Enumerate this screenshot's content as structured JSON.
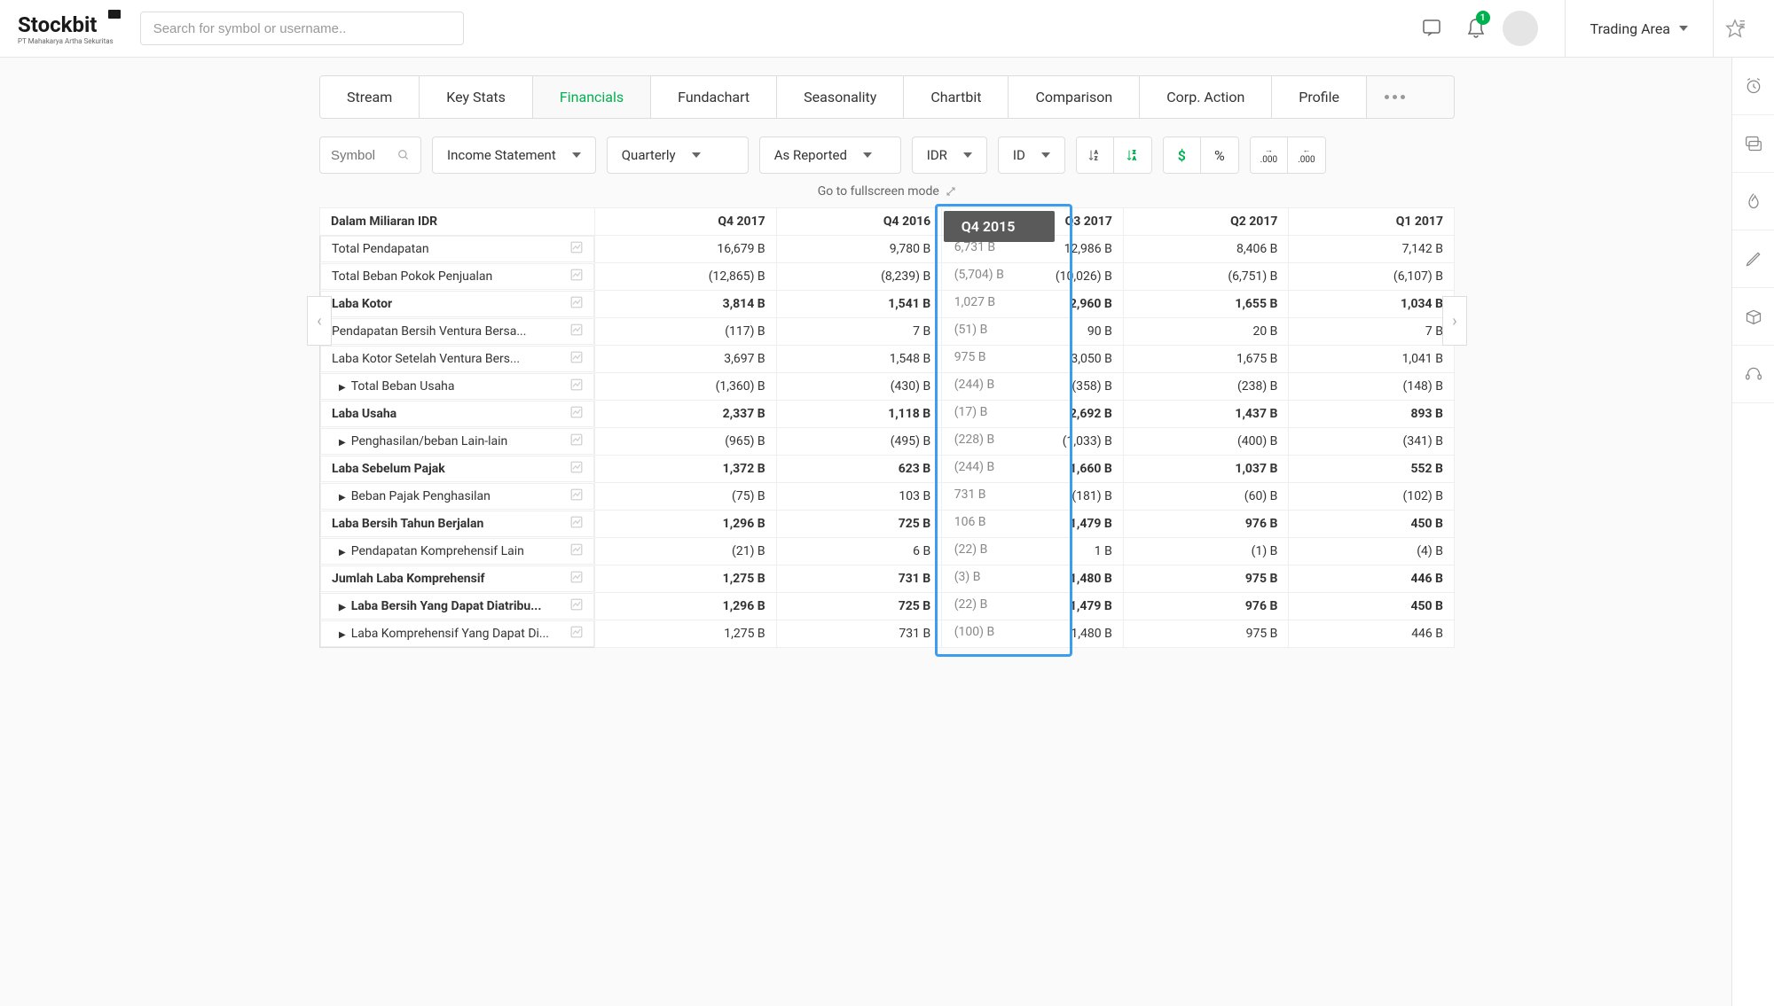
{
  "header": {
    "brand": "Stockbit",
    "brand_sub": "PT Mahakarya Artha Sekuritas",
    "search_placeholder": "Search for symbol or username..",
    "notif_badge": "1",
    "trading_area": "Trading Area"
  },
  "tabs": [
    "Stream",
    "Key Stats",
    "Financials",
    "Fundachart",
    "Seasonality",
    "Chartbit",
    "Comparison",
    "Corp. Action",
    "Profile"
  ],
  "active_tab": 2,
  "controls": {
    "symbol_placeholder": "Symbol",
    "statement": "Income Statement",
    "period": "Quarterly",
    "basis": "As Reported",
    "currency": "IDR",
    "locale": "ID",
    "dollar": "$",
    "percent": "%",
    "dec_inc": ".000",
    "dec_dec": ".000"
  },
  "fullscreen": "Go to fullscreen mode",
  "table_header_first": "Dalam Miliaran IDR",
  "columns": [
    "Q4 2017",
    "Q4 2016",
    "Q3 2017",
    "Q2 2017",
    "Q1 2017"
  ],
  "tooltip": {
    "header": "Q4 2015",
    "values": [
      "6,731 B",
      "(5,704) B",
      "1,027 B",
      "(51) B",
      "975 B",
      "(244) B",
      "(17) B",
      "(228) B",
      "(244) B",
      "731 B",
      "106 B",
      "(22) B",
      "(3) B",
      "(22) B",
      "(100) B"
    ]
  },
  "rows": [
    {
      "label": "Total Pendapatan",
      "bold": false,
      "indent": 0,
      "expand": false,
      "values": [
        "16,679 B",
        "9,780 B",
        "12,986 B",
        "8,406 B",
        "7,142 B"
      ]
    },
    {
      "label": "Total Beban Pokok Penjualan",
      "bold": false,
      "indent": 0,
      "expand": false,
      "values": [
        "(12,865) B",
        "(8,239) B",
        "(10,026) B",
        "(6,751) B",
        "(6,107) B"
      ]
    },
    {
      "label": "Laba Kotor",
      "bold": true,
      "indent": 0,
      "expand": false,
      "values": [
        "3,814 B",
        "1,541 B",
        "2,960 B",
        "1,655 B",
        "1,034 B"
      ]
    },
    {
      "label": "Pendapatan Bersih Ventura Bersa...",
      "bold": false,
      "indent": 0,
      "expand": false,
      "values": [
        "(117) B",
        "7 B",
        "90 B",
        "20 B",
        "7 B"
      ]
    },
    {
      "label": "Laba Kotor Setelah Ventura Bers...",
      "bold": false,
      "indent": 0,
      "expand": false,
      "values": [
        "3,697 B",
        "1,548 B",
        "3,050 B",
        "1,675 B",
        "1,041 B"
      ]
    },
    {
      "label": "Total Beban Usaha",
      "bold": false,
      "indent": 1,
      "expand": true,
      "values": [
        "(1,360) B",
        "(430) B",
        "(358) B",
        "(238) B",
        "(148) B"
      ]
    },
    {
      "label": "Laba Usaha",
      "bold": true,
      "indent": 0,
      "expand": false,
      "values": [
        "2,337 B",
        "1,118 B",
        "2,692 B",
        "1,437 B",
        "893 B"
      ]
    },
    {
      "label": "Penghasilan/beban Lain-lain",
      "bold": false,
      "indent": 1,
      "expand": true,
      "values": [
        "(965) B",
        "(495) B",
        "(1,033) B",
        "(400) B",
        "(341) B"
      ]
    },
    {
      "label": "Laba Sebelum Pajak",
      "bold": true,
      "indent": 0,
      "expand": false,
      "values": [
        "1,372 B",
        "623 B",
        "1,660 B",
        "1,037 B",
        "552 B"
      ]
    },
    {
      "label": "Beban Pajak Penghasilan",
      "bold": false,
      "indent": 1,
      "expand": true,
      "values": [
        "(75) B",
        "103 B",
        "(181) B",
        "(60) B",
        "(102) B"
      ]
    },
    {
      "label": "Laba Bersih Tahun Berjalan",
      "bold": true,
      "indent": 0,
      "expand": false,
      "values": [
        "1,296 B",
        "725 B",
        "1,479 B",
        "976 B",
        "450 B"
      ]
    },
    {
      "label": "Pendapatan Komprehensif Lain",
      "bold": false,
      "indent": 1,
      "expand": true,
      "values": [
        "(21) B",
        "6 B",
        "1 B",
        "(1) B",
        "(4) B"
      ]
    },
    {
      "label": "Jumlah Laba Komprehensif",
      "bold": true,
      "indent": 0,
      "expand": false,
      "values": [
        "1,275 B",
        "731 B",
        "1,480 B",
        "975 B",
        "446 B"
      ]
    },
    {
      "label": "Laba Bersih Yang Dapat Diatribu...",
      "bold": true,
      "indent": 1,
      "expand": true,
      "values": [
        "1,296 B",
        "725 B",
        "1,479 B",
        "976 B",
        "450 B"
      ]
    },
    {
      "label": "Laba Komprehensif Yang Dapat Di...",
      "bold": false,
      "indent": 1,
      "expand": true,
      "values": [
        "1,275 B",
        "731 B",
        "1,480 B",
        "975 B",
        "446 B"
      ]
    }
  ]
}
